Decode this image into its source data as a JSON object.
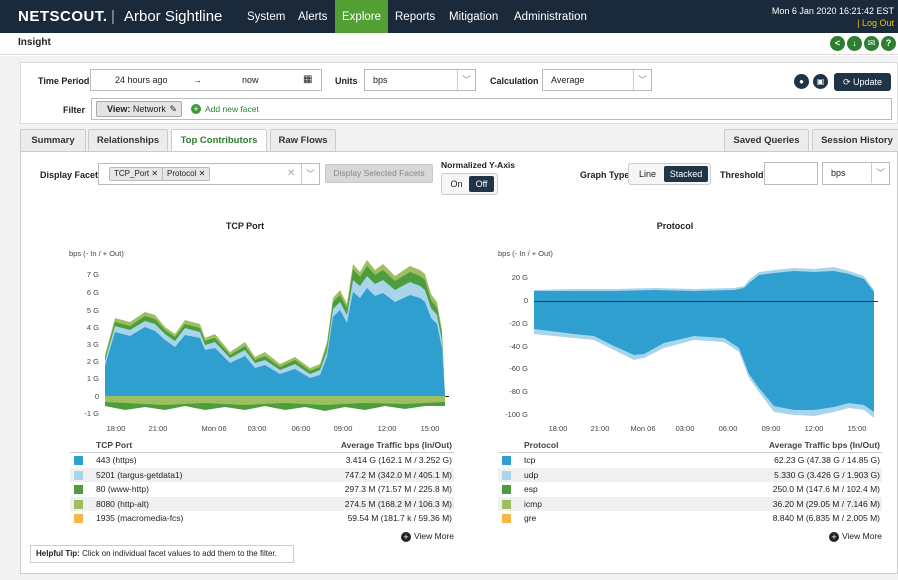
{
  "app": {
    "brand": "NETSCOUT.",
    "product": "Arbor Sightline",
    "datetime": "Mon 6 Jan 2020 16:21:42 EST",
    "logout": "| Log Out"
  },
  "nav": [
    "System",
    "Alerts",
    "Explore",
    "Reports",
    "Mitigation",
    "Administration"
  ],
  "nav_active": "Explore",
  "page_title": "Insight",
  "header_icons": [
    "share-icon",
    "download-icon",
    "mail-icon",
    "help-icon"
  ],
  "controls": {
    "time_period_label": "Time Period",
    "time_from": "24 hours ago",
    "time_arrow": "→",
    "time_to": "now",
    "units_label": "Units",
    "units_value": "bps",
    "calc_label": "Calculation",
    "calc_value": "Average",
    "update_label": "Update",
    "filter_label": "Filter",
    "view_prefix": "View:",
    "view_value": "Network",
    "add_facet": "Add new facet"
  },
  "tabs_left": [
    "Summary",
    "Relationships",
    "Top Contributors",
    "Raw Flows"
  ],
  "tab_active": "Top Contributors",
  "tabs_right": [
    "Saved Queries",
    "Session History"
  ],
  "display": {
    "facets_label": "Display Facets",
    "chips": [
      "TCP_Port",
      "Protocol"
    ],
    "display_selected": "Display Selected Facets",
    "normalized_label": "Normalized Y-Axis",
    "norm_on": "On",
    "norm_off": "Off",
    "graph_type_label": "Graph Type",
    "graph_line": "Line",
    "graph_stacked": "Stacked",
    "threshold_label": "Threshold",
    "threshold_unit": "bps"
  },
  "colors": {
    "nav_bg": "#1b2a3a",
    "active_green": "#52a033",
    "series": [
      "#2f9fd0",
      "#a8d4ec",
      "#4d9c3d",
      "#9dbf5f",
      "#f7b64a"
    ]
  },
  "charts": [
    {
      "title": "TCP Port",
      "yunit": "bps (- In / + Out)",
      "yticks": [
        "7 G",
        "6 G",
        "5 G",
        "4 G",
        "3 G",
        "2 G",
        "1 G",
        "0",
        "-1 G"
      ],
      "xticks": [
        "18:00",
        "21:00",
        "Mon 06",
        "03:00",
        "06:00",
        "09:00",
        "12:00",
        "15:00"
      ],
      "col_name": "TCP Port",
      "col_value": "Average Traffic bps (In/Out)",
      "rows": [
        {
          "name": "443 (https)",
          "value": "3.414 G (162.1 M / 3.252 G)"
        },
        {
          "name": "5201 (targus-getdata1)",
          "value": "747.2 M (342.0 M / 405.1 M)"
        },
        {
          "name": "80 (www-http)",
          "value": "297.3 M (71.57 M / 225.8 M)"
        },
        {
          "name": "8080 (http-alt)",
          "value": "274.5 M (168.2 M / 106.3 M)"
        },
        {
          "name": "1935 (macromedia-fcs)",
          "value": "59.54 M (181.7 k / 59.36 M)"
        }
      ],
      "view_more": "View More"
    },
    {
      "title": "Protocol",
      "yunit": "bps (- In / + Out)",
      "yticks": [
        "20 G",
        "0",
        "-20 G",
        "-40 G",
        "-60 G",
        "-80 G",
        "-100 G"
      ],
      "xticks": [
        "18:00",
        "21:00",
        "Mon 06",
        "03:00",
        "06:00",
        "09:00",
        "12:00",
        "15:00"
      ],
      "col_name": "Protocol",
      "col_value": "Average Traffic bps (In/Out)",
      "rows": [
        {
          "name": "tcp",
          "value": "62.23 G (47.38 G / 14.85 G)"
        },
        {
          "name": "udp",
          "value": "5.330 G (3.426 G / 1.903 G)"
        },
        {
          "name": "esp",
          "value": "250.0 M (147.6 M / 102.4 M)"
        },
        {
          "name": "icmp",
          "value": "36.20 M (29.05 M / 7.146 M)"
        },
        {
          "name": "gre",
          "value": "8.840 M (6.835 M / 2.005 M)"
        }
      ],
      "view_more": "View More"
    }
  ],
  "tip": {
    "bold": "Helpful Tip:",
    "text": " Click on individual facet values to add them to the filter."
  }
}
